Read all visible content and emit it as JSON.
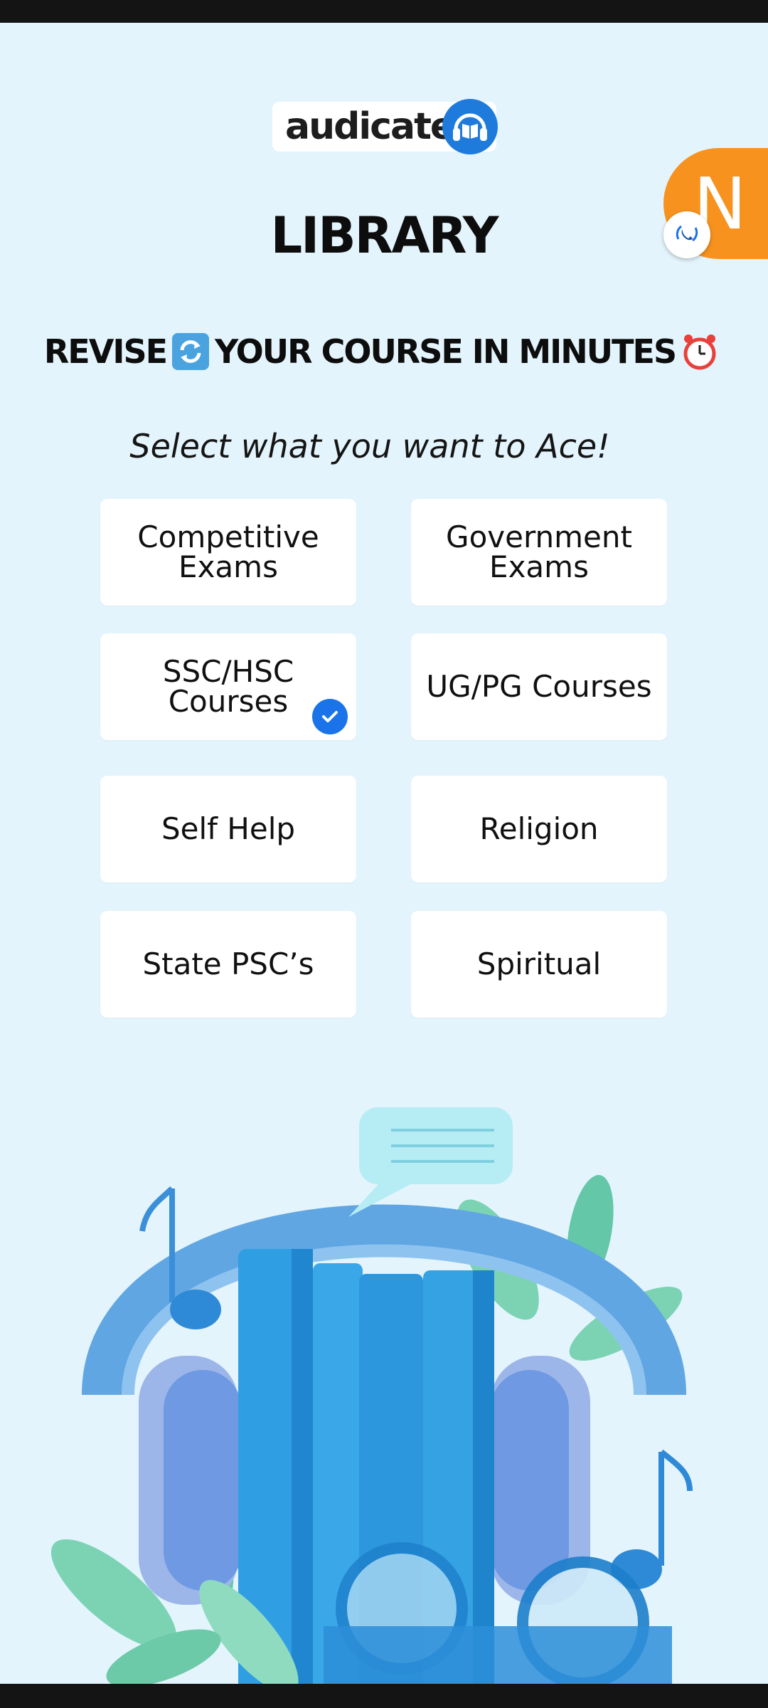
{
  "app": {
    "logo_text": "audicate",
    "title": "LIBRARY",
    "tagline": {
      "part1": "REVISE",
      "part2": "YOUR COURSE IN MINUTES"
    },
    "subtitle": "Select what you want to Ace!",
    "fab_letter": "N"
  },
  "categories": [
    {
      "label": "Competitive\nExams",
      "selected": false
    },
    {
      "label": "Government\nExams",
      "selected": false
    },
    {
      "label": "SSC/HSC\nCourses",
      "selected": true
    },
    {
      "label": "UG/PG Courses",
      "selected": false
    },
    {
      "label": "Self Help",
      "selected": false
    },
    {
      "label": "Religion",
      "selected": false
    },
    {
      "label": "State PSC’s",
      "selected": false
    },
    {
      "label": "Spiritual",
      "selected": false
    }
  ],
  "icons": {
    "logo": "headphones-book-icon",
    "revise": "refresh-icon",
    "minutes": "alarm-clock-icon",
    "selected": "check-circle-icon",
    "call": "call-icon"
  },
  "colors": {
    "background": "#e4f4fc",
    "accent": "#1a73e8",
    "fab": "#f7921e"
  }
}
